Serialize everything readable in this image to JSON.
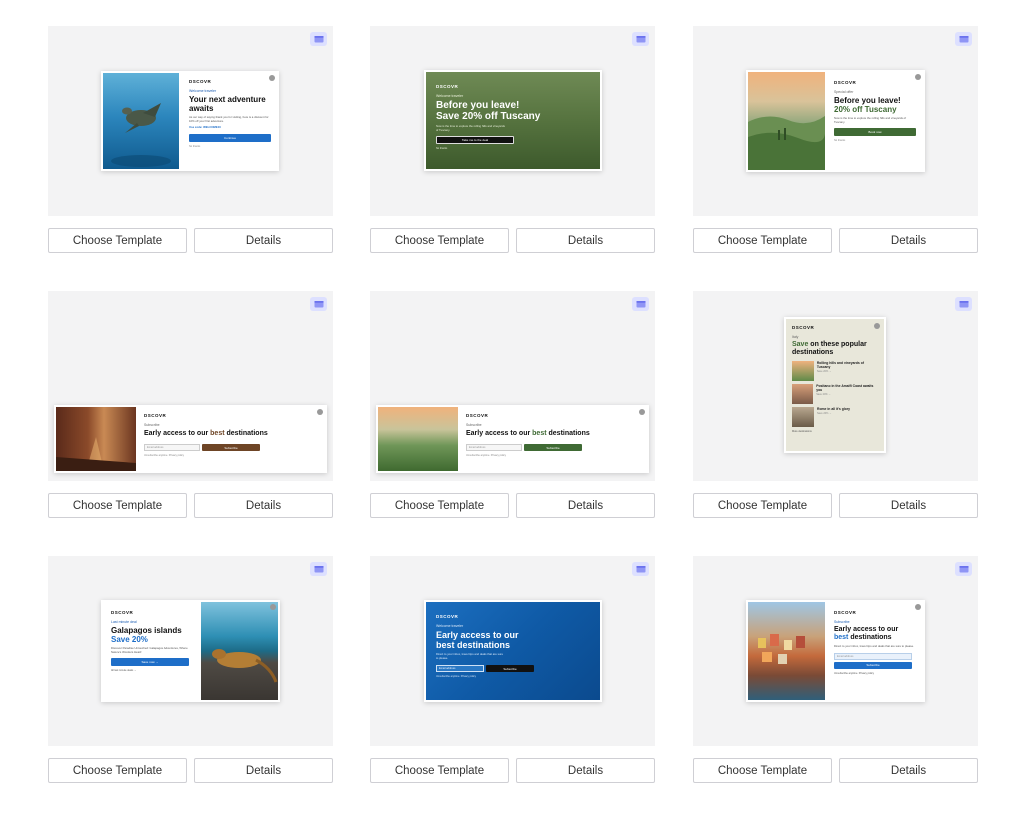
{
  "buttons": {
    "choose": "Choose Template",
    "details": "Details"
  },
  "templates": [
    {
      "logo": "DSCOVR",
      "eyebrow": "Welcome traveler",
      "title": "Your next adventure awaits",
      "body": "As our way of saying thank you for visiting, here is a discount for 10% off your first adventure.",
      "code": "Use code: WELCOME10",
      "cta": "Continue",
      "dismiss": "No thanks"
    },
    {
      "logo": "DSCOVR",
      "eyebrow": "Welcome traveler",
      "title_line1": "Before you leave!",
      "title_line2": "Save 20% off Tuscany",
      "body": "Now is the time to explore the rolling hills and vineyards of Tuscany.",
      "cta": "Take me to the deal",
      "dismiss": "No thanks"
    },
    {
      "logo": "DSCOVR",
      "eyebrow": "Special offer",
      "title_line1": "Before you leave!",
      "title_line2": "20% off Tuscany",
      "body": "Now is the time to explore the rolling hills and vineyards of Tuscany.",
      "cta": "Book now",
      "dismiss": "No thanks"
    },
    {
      "logo": "DSCOVR",
      "eyebrow": "Subscribe",
      "title_pre": "Early access to our ",
      "title_accent": "best",
      "title_post": " destinations",
      "placeholder": "Email address",
      "cta": "Subscribe",
      "note": "Unsubscribe anytime. Privacy policy"
    },
    {
      "logo": "DSCOVR",
      "eyebrow": "Subscribe",
      "title_pre": "Early access to our ",
      "title_accent": "best",
      "title_post": " destinations",
      "placeholder": "Email address",
      "cta": "Subscribe",
      "note": "Unsubscribe anytime. Privacy policy"
    },
    {
      "logo": "DSCOVR",
      "eyebrow": "Italy",
      "title_accent": "Save",
      "title_rest": " on these popular destinations",
      "items": [
        {
          "title": "Rolling hills and vineyards of Tuscany",
          "sub": "Save 20% →"
        },
        {
          "title": "Positano in the Amalfi Coast awaits you",
          "sub": "Save 20% →"
        },
        {
          "title": "Rome in all it's glory",
          "sub": "Save 20% →"
        }
      ],
      "more": "More destinations"
    },
    {
      "logo": "DSCOVR",
      "eyebrow": "Last minute deal",
      "title": "Galapagos islands",
      "title_accent": "Save 20%",
      "body": "Discover Paradise Untouched: Galapagos Adventures, Where Nature's Wonders Await!",
      "cta": "Save now →",
      "more": "All last minute deals →"
    },
    {
      "logo": "DSCOVR",
      "eyebrow": "Welcome traveler",
      "title_line1": "Early access to our",
      "title_line2": "best destinations",
      "body": "Direct to your inbox, travel tips and deals that are sure to please.",
      "placeholder": "Email address",
      "cta": "Subscribe",
      "note": "Unsubscribe anytime. Privacy policy"
    },
    {
      "logo": "DSCOVR",
      "eyebrow": "Subscribe",
      "title_line1": "Early access to our",
      "title_accent": "best",
      "title_rest": " destinations",
      "body": "Direct to your inbox, travel tips and deals that are sure to please.",
      "placeholder": "Email address",
      "cta": "Subscribe",
      "note": "Unsubscribe anytime. Privacy policy"
    }
  ]
}
